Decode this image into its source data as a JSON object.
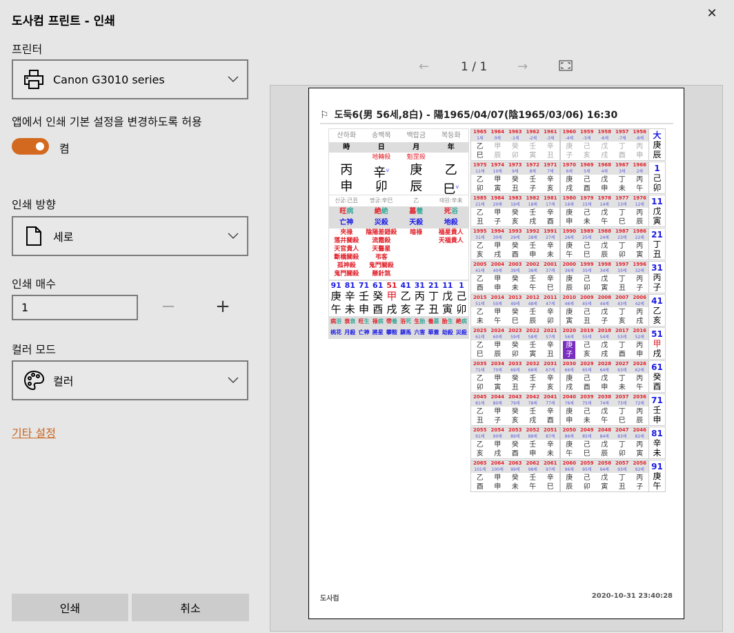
{
  "dialog": {
    "title": "도사컴 프린트 - 인쇄",
    "close": "✕"
  },
  "printer": {
    "label": "프린터",
    "value": "Canon G3010 series"
  },
  "allow": {
    "label": "앱에서 인쇄 기본 설정을 변경하도록 허용",
    "state": "켬",
    "on": true
  },
  "orientation": {
    "label": "인쇄 방향",
    "value": "세로"
  },
  "copies": {
    "label": "인쇄 매수",
    "value": "1",
    "minus": "−",
    "plus": "+"
  },
  "color": {
    "label": "컬러 모드",
    "value": "컬러"
  },
  "more": "기타 설정",
  "buttons": {
    "print": "인쇄",
    "cancel": "취소"
  },
  "nav": {
    "prev": "←",
    "page": "1  /  1",
    "next": "→"
  },
  "colors": {
    "accent": "#d2691e",
    "red": "#e0202a",
    "blue": "#1a1ae6",
    "teal": "#3aa89a",
    "highlight": "#7a2ec0"
  },
  "preview": {
    "title": "도둑6(男 56세,8白) - 陽1965/04/07(陰1965/03/06) 16:30",
    "footer_left": "도사컴",
    "footer_right": "2020-10-31 23:40:28",
    "saju": {
      "napeum": [
        "산하화",
        "송백목",
        "백랍금",
        "복등화"
      ],
      "pillars_head": [
        "時",
        "日",
        "月",
        "年"
      ],
      "top_sinsal": [
        "",
        "地轉殺",
        "魁罡殺",
        ""
      ],
      "stems": [
        "丙",
        "辛",
        "庚",
        "乙"
      ],
      "branches": [
        "申",
        "卯",
        "辰",
        "巳"
      ],
      "marks": [
        "",
        "v",
        "",
        "v"
      ],
      "info": [
        "신궁:己丑",
        "명궁:辛巳",
        "乙",
        "태원:辛未"
      ],
      "unseong": [
        [
          "旺",
          "病"
        ],
        [
          "絶",
          "絶"
        ],
        [
          "墓",
          "養"
        ],
        [
          "死",
          "浴"
        ]
      ],
      "sinsal": [
        "亡神",
        "災殺",
        "天殺",
        "地殺"
      ],
      "extra": [
        [
          "夾祿",
          "落井關殺",
          "天官貴人",
          "斷橋關殺",
          "孤神殺",
          "鬼門關殺"
        ],
        [
          "陰陽差錯殺",
          "流霞殺",
          "天醫星",
          "弔客",
          "鬼門關殺",
          "懸針煞"
        ],
        [
          "暗祿"
        ],
        [
          "福星貴人",
          "天福貴人"
        ]
      ],
      "daeun_ages": [
        "91",
        "81",
        "71",
        "61",
        "51",
        "41",
        "31",
        "21",
        "11",
        "1"
      ],
      "daeun_stems": [
        "庚",
        "辛",
        "壬",
        "癸",
        "甲",
        "乙",
        "丙",
        "丁",
        "戊",
        "己"
      ],
      "daeun_branches": [
        "午",
        "未",
        "申",
        "酉",
        "戌",
        "亥",
        "子",
        "丑",
        "寅",
        "卯"
      ],
      "daeun_current": "51",
      "daeun_unseong": [
        [
          "病",
          "浴"
        ],
        [
          "衰",
          "衰"
        ],
        [
          "旺",
          "生"
        ],
        [
          "祿",
          "病"
        ],
        [
          "帶",
          "養"
        ],
        [
          "浴",
          "死"
        ],
        [
          "生",
          "胎"
        ],
        [
          "養",
          "墓"
        ],
        [
          "胎",
          "生"
        ],
        [
          "絶",
          "病"
        ]
      ],
      "daeun_sinsal": [
        "桃花",
        "月殺",
        "亡神",
        "將星",
        "攀鞍",
        "驛馬",
        "六害",
        "華蓋",
        "劫殺",
        "災殺"
      ]
    },
    "yearly": {
      "highlight": "2020",
      "rows": [
        {
          "years": [
            "1965",
            "1964",
            "1963",
            "1962",
            "1961",
            "1960",
            "1959",
            "1958",
            "1957",
            "1956"
          ],
          "ages": [
            "1세",
            "0세",
            "-1세",
            "-2세",
            "-3세",
            "-4세",
            "-5세",
            "-6세",
            "-7세",
            "-8세"
          ],
          "pillars": [
            "乙巳",
            "甲辰",
            "癸卯",
            "壬寅",
            "辛丑",
            "庚子",
            "己亥",
            "戊戌",
            "丁酉",
            "丙申"
          ],
          "daeun": [
            "大",
            "庚",
            "辰"
          ]
        },
        {
          "years": [
            "1975",
            "1974",
            "1973",
            "1972",
            "1971",
            "1970",
            "1969",
            "1968",
            "1967",
            "1966"
          ],
          "ages": [
            "11세",
            "10세",
            "9세",
            "8세",
            "7세",
            "6세",
            "5세",
            "4세",
            "3세",
            "2세"
          ],
          "pillars": [
            "乙卯",
            "甲寅",
            "癸丑",
            "壬子",
            "辛亥",
            "庚戌",
            "己酉",
            "戊申",
            "丁未",
            "丙午"
          ],
          "daeun": [
            "1",
            "己",
            "卯"
          ]
        },
        {
          "years": [
            "1985",
            "1984",
            "1983",
            "1982",
            "1981",
            "1980",
            "1979",
            "1978",
            "1977",
            "1976"
          ],
          "ages": [
            "21세",
            "20세",
            "19세",
            "18세",
            "17세",
            "16세",
            "15세",
            "14세",
            "13세",
            "12세"
          ],
          "pillars": [
            "乙丑",
            "甲子",
            "癸亥",
            "壬戌",
            "辛酉",
            "庚申",
            "己未",
            "戊午",
            "丁巳",
            "丙辰"
          ],
          "daeun": [
            "11",
            "戊",
            "寅"
          ]
        },
        {
          "years": [
            "1995",
            "1994",
            "1993",
            "1992",
            "1991",
            "1990",
            "1989",
            "1988",
            "1987",
            "1986"
          ],
          "ages": [
            "31세",
            "30세",
            "29세",
            "28세",
            "27세",
            "26세",
            "25세",
            "24세",
            "23세",
            "22세"
          ],
          "pillars": [
            "乙亥",
            "甲戌",
            "癸酉",
            "壬申",
            "辛未",
            "庚午",
            "己巳",
            "戊辰",
            "丁卯",
            "丙寅"
          ],
          "daeun": [
            "21",
            "丁",
            "丑"
          ]
        },
        {
          "years": [
            "2005",
            "2004",
            "2003",
            "2002",
            "2001",
            "2000",
            "1999",
            "1998",
            "1997",
            "1996"
          ],
          "ages": [
            "41세",
            "40세",
            "39세",
            "38세",
            "37세",
            "36세",
            "35세",
            "34세",
            "33세",
            "32세"
          ],
          "pillars": [
            "乙酉",
            "甲申",
            "癸未",
            "壬午",
            "辛巳",
            "庚辰",
            "己卯",
            "戊寅",
            "丁丑",
            "丙子"
          ],
          "daeun": [
            "31",
            "丙",
            "子"
          ]
        },
        {
          "years": [
            "2015",
            "2014",
            "2013",
            "2012",
            "2011",
            "2010",
            "2009",
            "2008",
            "2007",
            "2006"
          ],
          "ages": [
            "51세",
            "50세",
            "49세",
            "48세",
            "47세",
            "46세",
            "45세",
            "44세",
            "43세",
            "42세"
          ],
          "pillars": [
            "乙未",
            "甲午",
            "癸巳",
            "壬辰",
            "辛卯",
            "庚寅",
            "己丑",
            "戊子",
            "丁亥",
            "丙戌"
          ],
          "daeun": [
            "41",
            "乙",
            "亥"
          ]
        },
        {
          "years": [
            "2025",
            "2024",
            "2023",
            "2022",
            "2021",
            "2020",
            "2019",
            "2018",
            "2017",
            "2016"
          ],
          "ages": [
            "61세",
            "60세",
            "59세",
            "58세",
            "57세",
            "56세",
            "55세",
            "54세",
            "53세",
            "52세"
          ],
          "pillars": [
            "乙巳",
            "甲辰",
            "癸卯",
            "壬寅",
            "辛丑",
            "庚子",
            "己亥",
            "戊戌",
            "丁酉",
            "丙申"
          ],
          "daeun": [
            "51",
            "甲",
            "戌"
          ]
        },
        {
          "years": [
            "2035",
            "2034",
            "2033",
            "2032",
            "2031",
            "2030",
            "2029",
            "2028",
            "2027",
            "2026"
          ],
          "ages": [
            "71세",
            "70세",
            "69세",
            "68세",
            "67세",
            "66세",
            "65세",
            "64세",
            "63세",
            "62세"
          ],
          "pillars": [
            "乙卯",
            "甲寅",
            "癸丑",
            "壬子",
            "辛亥",
            "庚戌",
            "己酉",
            "戊申",
            "丁未",
            "丙午"
          ],
          "daeun": [
            "61",
            "癸",
            "酉"
          ]
        },
        {
          "years": [
            "2045",
            "2044",
            "2043",
            "2042",
            "2041",
            "2040",
            "2039",
            "2038",
            "2037",
            "2036"
          ],
          "ages": [
            "81세",
            "80세",
            "79세",
            "78세",
            "77세",
            "76세",
            "75세",
            "74세",
            "73세",
            "72세"
          ],
          "pillars": [
            "乙丑",
            "甲子",
            "癸亥",
            "壬戌",
            "辛酉",
            "庚申",
            "己未",
            "戊午",
            "丁巳",
            "丙辰"
          ],
          "daeun": [
            "71",
            "壬",
            "申"
          ]
        },
        {
          "years": [
            "2055",
            "2054",
            "2053",
            "2052",
            "2051",
            "2050",
            "2049",
            "2048",
            "2047",
            "2046"
          ],
          "ages": [
            "91세",
            "90세",
            "89세",
            "88세",
            "87세",
            "86세",
            "85세",
            "84세",
            "83세",
            "82세"
          ],
          "pillars": [
            "乙亥",
            "甲戌",
            "癸酉",
            "壬申",
            "辛未",
            "庚午",
            "己巳",
            "戊辰",
            "丁卯",
            "丙寅"
          ],
          "daeun": [
            "81",
            "辛",
            "未"
          ]
        },
        {
          "years": [
            "2065",
            "2064",
            "2063",
            "2062",
            "2061",
            "2060",
            "2059",
            "2058",
            "2057",
            "2056"
          ],
          "ages": [
            "101세",
            "100세",
            "99세",
            "98세",
            "97세",
            "96세",
            "95세",
            "94세",
            "93세",
            "92세"
          ],
          "pillars": [
            "乙酉",
            "甲申",
            "癸未",
            "壬午",
            "辛巳",
            "庚辰",
            "己卯",
            "戊寅",
            "丁丑",
            "丙子"
          ],
          "daeun": [
            "91",
            "庚",
            "午"
          ]
        }
      ]
    }
  }
}
